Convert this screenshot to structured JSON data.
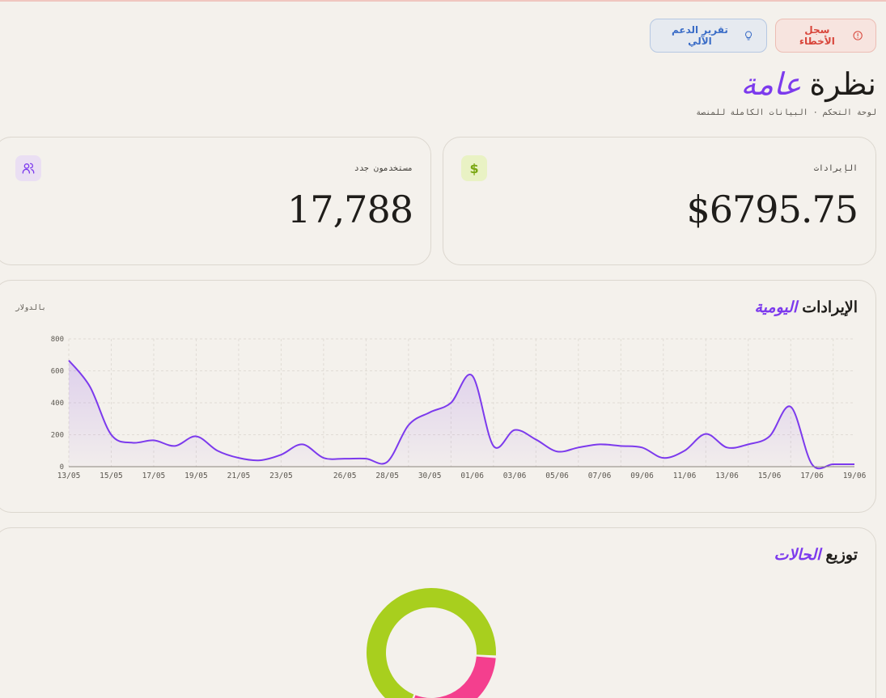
{
  "header": {
    "errors_button": "سجل الأخطاء",
    "report_button": "تقرير الدعم الآلي",
    "title_plain": "نظرة",
    "title_accent": "عامة",
    "subtitle": "لوحة التحكم · البيانات الكاملة للمنصة"
  },
  "stats": {
    "revenue": {
      "label": "الإيرادات",
      "value": "$6795.75",
      "icon": "dollar-icon"
    },
    "users": {
      "label": "مستخدمون جدد",
      "value": "17,788",
      "icon": "users-icon"
    }
  },
  "revenue_section": {
    "title_plain": "الإيرادات",
    "title_accent": "اليومية",
    "unit": "بالدولار"
  },
  "distribution_section": {
    "title_plain": "توزيع",
    "title_accent": "الحالات"
  },
  "colors": {
    "accent": "#7c3aed",
    "error": "#d8453a",
    "info": "#3b6dc7",
    "lime": "#a8cf1e",
    "pink": "#f43f8e"
  },
  "chart_data": [
    {
      "type": "area",
      "x": [
        "13/05",
        "14/05",
        "15/05",
        "16/05",
        "17/05",
        "18/05",
        "19/05",
        "20/05",
        "21/05",
        "22/05",
        "23/05",
        "24/05",
        "25/05",
        "26/05",
        "27/05",
        "28/05",
        "29/05",
        "30/05",
        "31/05",
        "01/06",
        "02/06",
        "03/06",
        "04/06",
        "05/06",
        "06/06",
        "07/06",
        "08/06",
        "09/06",
        "10/06",
        "11/06",
        "12/06",
        "13/06",
        "14/06",
        "15/06",
        "16/06",
        "17/06",
        "18/06",
        "19/06"
      ],
      "tick_labels": [
        "13/05",
        "15/05",
        "17/05",
        "19/05",
        "21/05",
        "23/05",
        "26/05",
        "28/05",
        "30/05",
        "01/06",
        "03/06",
        "05/06",
        "07/06",
        "09/06",
        "11/06",
        "13/06",
        "15/06",
        "17/06",
        "19/06"
      ],
      "series": [
        {
          "values": [
            665,
            500,
            200,
            150,
            165,
            130,
            190,
            100,
            55,
            40,
            75,
            140,
            55,
            50,
            50,
            30,
            260,
            340,
            400,
            570,
            130,
            230,
            170,
            95,
            120,
            140,
            130,
            120,
            55,
            100,
            205,
            120,
            140,
            190,
            375,
            15,
            15,
            15
          ]
        }
      ],
      "ylim": [
        0,
        800
      ],
      "yticks": [
        0,
        200,
        400,
        600,
        800
      ],
      "grid": true,
      "color": "#7c3aed"
    },
    {
      "type": "pie",
      "donut": true,
      "categories": [
        "",
        ""
      ],
      "values": [
        70,
        30
      ],
      "colors": [
        "#a8cf1e",
        "#f43f8e"
      ]
    }
  ]
}
